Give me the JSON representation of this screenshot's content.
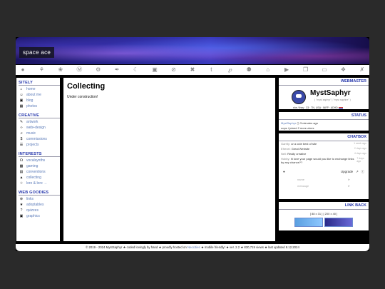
{
  "banner": {
    "title": "space ace"
  },
  "iconbar": [
    "●",
    "⚘",
    "❀",
    "Ⓜ",
    "⚙",
    "✒",
    "☾",
    "▣",
    "⊘",
    "✖",
    "t",
    "℘",
    "⚉",
    "⌂",
    "▶",
    "❐",
    "▭",
    "❖",
    "✗"
  ],
  "sidebar": {
    "sitely": {
      "heading": "SITELY",
      "items": [
        {
          "icon": "⌂",
          "label": "home"
        },
        {
          "icon": "☺",
          "label": "about me"
        },
        {
          "icon": "▣",
          "label": "blog"
        },
        {
          "icon": "▦",
          "label": "photos"
        }
      ]
    },
    "creative": {
      "heading": "CREATIVE",
      "items": [
        {
          "icon": "✎",
          "label": "artwork"
        },
        {
          "icon": "‹›",
          "label": "web+design"
        },
        {
          "icon": "♫",
          "label": "music"
        },
        {
          "icon": "$",
          "label": "commissions"
        },
        {
          "icon": "☰",
          "label": "projects"
        }
      ]
    },
    "interests": {
      "heading": "INTERESTS",
      "items": [
        {
          "icon": "☊",
          "label": "vocalsynths"
        },
        {
          "icon": "▩",
          "label": "gaming"
        },
        {
          "icon": "▤",
          "label": "conventions"
        },
        {
          "icon": "▲",
          "label": "collecting"
        },
        {
          "icon": "☆",
          "label": "lore & lore →"
        }
      ]
    },
    "goodies": {
      "heading": "WEB GOODIES",
      "items": [
        {
          "icon": "⊕",
          "label": "links"
        },
        {
          "icon": "★",
          "label": "adoptables"
        },
        {
          "icon": "?",
          "label": "quizzes"
        },
        {
          "icon": "▣",
          "label": "graphics"
        }
      ]
    }
  },
  "main": {
    "title": "Collecting",
    "body": "Under construction!"
  },
  "webmaster": {
    "heading": "WEBMASTER",
    "name": "MystSaphyr",
    "alias": "( \"myst saphyr\" | \"myst saphire\" )",
    "info": "she / they · 33 · TN, USA · INFP · ADHD"
  },
  "status": {
    "heading": "STATUS",
    "user": "MystSaphyr",
    "time": "3 minutes ago",
    "text": "oops i joined 2 more zines"
  },
  "chatbox": {
    "heading": "CHATBOX",
    "messages": [
      {
        "who": "Garrity:",
        "text": "ur a cute best of site",
        "time": "1 week ago"
      },
      {
        "who": "Efrevel:",
        "text": "Great Website",
        "time": "2 days ago"
      },
      {
        "who": "Nell:",
        "text": "Really creative",
        "time": "4 days ago"
      },
      {
        "who": "Hobby:",
        "text": "hi love your page would you like to exchange links by any chance??",
        "time": "7 days ago"
      }
    ],
    "upgrade": "Upgrade",
    "name_placeholder": "name",
    "message_placeholder": "message"
  },
  "linkback": {
    "heading": "LINK BACK",
    "sizes": "[ 88 x 31 ]   [ 200 x 40 ]"
  },
  "footer": {
    "copy": "© 2019 - 2024 MystSaphyr",
    "coded": "coded lovingly by hand",
    "hosted_pre": "proudly hosted on",
    "hosted_link": "Neocities",
    "mobile": "mobile friendly!",
    "ver": "ver. 2.2",
    "views": "830,719 views",
    "updated": "last updated 8.12.2024"
  }
}
